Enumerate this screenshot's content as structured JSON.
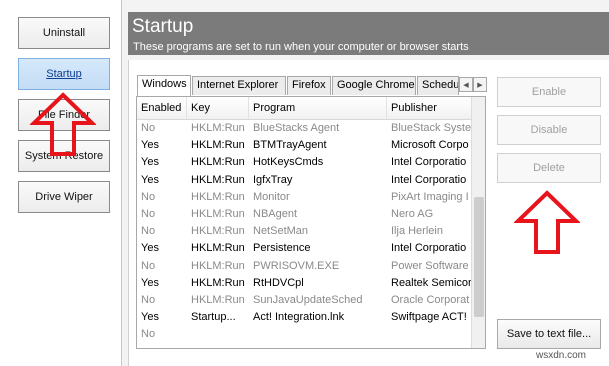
{
  "nav": {
    "items": [
      "Uninstall",
      "Startup",
      "File Finder",
      "System Restore",
      "Drive Wiper"
    ],
    "active_index": 1
  },
  "header": {
    "title": "Startup",
    "subtitle": "These programs are set to run when your computer or browser starts"
  },
  "tabs": [
    "Windows",
    "Internet Explorer",
    "Firefox",
    "Google Chrome",
    "Schedu"
  ],
  "table": {
    "columns": [
      "Enabled",
      "Key",
      "Program",
      "Publisher"
    ],
    "rows": [
      {
        "enabled": "No",
        "key": "HKLM:Run",
        "program": "BlueStacks Agent",
        "publisher": "BlueStack Syste"
      },
      {
        "enabled": "Yes",
        "key": "HKLM:Run",
        "program": "BTMTrayAgent",
        "publisher": "Microsoft Corpo"
      },
      {
        "enabled": "Yes",
        "key": "HKLM:Run",
        "program": "HotKeysCmds",
        "publisher": "Intel Corporatio"
      },
      {
        "enabled": "Yes",
        "key": "HKLM:Run",
        "program": "IgfxTray",
        "publisher": "Intel Corporatio"
      },
      {
        "enabled": "No",
        "key": "HKLM:Run",
        "program": "Monitor",
        "publisher": "PixArt Imaging I"
      },
      {
        "enabled": "No",
        "key": "HKLM:Run",
        "program": "NBAgent",
        "publisher": "Nero AG"
      },
      {
        "enabled": "No",
        "key": "HKLM:Run",
        "program": "NetSetMan",
        "publisher": "Ilja Herlein"
      },
      {
        "enabled": "Yes",
        "key": "HKLM:Run",
        "program": "Persistence",
        "publisher": "Intel Corporatio"
      },
      {
        "enabled": "No",
        "key": "HKLM:Run",
        "program": "PWRISOVM.EXE",
        "publisher": "Power Software"
      },
      {
        "enabled": "Yes",
        "key": "HKLM:Run",
        "program": "RtHDVCpl",
        "publisher": "Realtek Semicor"
      },
      {
        "enabled": "No",
        "key": "HKLM:Run",
        "program": "SunJavaUpdateSched",
        "publisher": "Oracle Corporat"
      },
      {
        "enabled": "Yes",
        "key": "Startup...",
        "program": "Act! Integration.lnk",
        "publisher": "Swiftpage ACT!"
      },
      {
        "enabled": "No",
        "key": "",
        "program": "",
        "publisher": ""
      }
    ]
  },
  "buttons": {
    "enable": "Enable",
    "disable": "Disable",
    "delete": "Delete",
    "save": "Save to text file..."
  },
  "watermark": "wsxdn.com",
  "colors": {
    "annotation_arrow": "#e8141c",
    "header_bg": "#7b7b7b",
    "active_nav": "#c3dcf5"
  },
  "icons": {
    "tab_scroll_left": "triangle-left",
    "tab_scroll_right": "triangle-right"
  }
}
